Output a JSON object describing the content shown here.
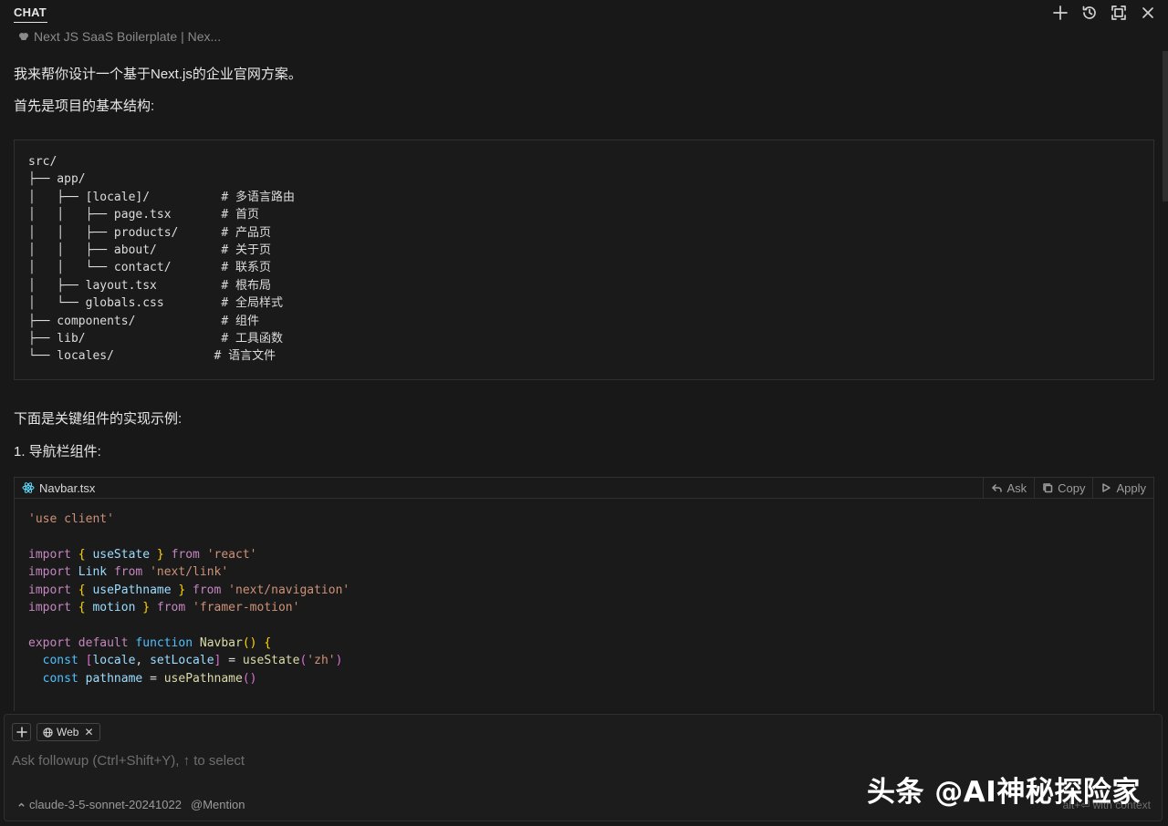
{
  "header": {
    "tab": "CHAT",
    "context_label": "Next JS SaaS Boilerplate | Nex..."
  },
  "message": {
    "p1": "我来帮你设计一个基于Next.js的企业官网方案。",
    "p2": "首先是项目的基本结构:",
    "tree": "src/\n├── app/\n│   ├── [locale]/          # 多语言路由\n│   │   ├── page.tsx       # 首页\n│   │   ├── products/      # 产品页\n│   │   ├── about/         # 关于页\n│   │   └── contact/       # 联系页\n│   ├── layout.tsx         # 根布局\n│   └── globals.css        # 全局样式\n├── components/            # 组件\n├── lib/                   # 工具函数\n└── locales/              # 语言文件",
    "p3": "下面是关键组件的实现示例:",
    "p4": "1. 导航栏组件:"
  },
  "code_block": {
    "file_name": "Navbar.tsx",
    "actions": {
      "ask": "Ask",
      "copy": "Copy",
      "apply": "Apply"
    },
    "tokens": {
      "use_client": "'use client'",
      "import": "import",
      "from": "from",
      "use_state": "useState",
      "react": "'react'",
      "link": "Link",
      "next_link": "'next/link'",
      "use_pathname": "usePathname",
      "next_navigation": "'next/navigation'",
      "motion": "motion",
      "framer_motion": "'framer-motion'",
      "export": "export",
      "default": "default",
      "function": "function",
      "navbar": "Navbar",
      "const": "const",
      "locale": "locale",
      "set_locale": "setLocale",
      "zh": "'zh'",
      "pathname": "pathname"
    }
  },
  "input": {
    "web_chip": "Web",
    "placeholder": "Ask followup (Ctrl+Shift+Y), ↑ to select",
    "model": "claude-3-5-sonnet-20241022",
    "mention": "@Mention",
    "hint": "alt+⏎ with context"
  },
  "watermark": "头条 @AI神秘探险家",
  "colors": {
    "background": "#181818",
    "keyword": "#c586c0",
    "string": "#ce9178",
    "variable": "#9cdcfe",
    "function": "#dcdcaa"
  }
}
